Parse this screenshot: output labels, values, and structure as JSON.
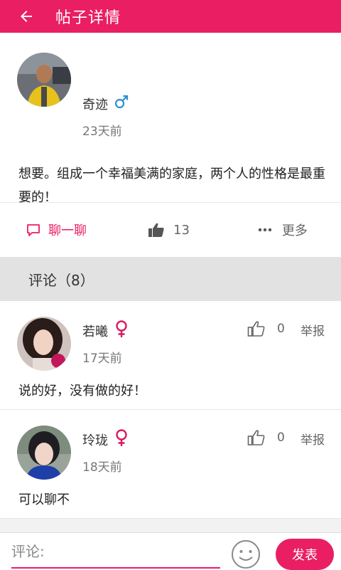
{
  "header": {
    "title": "帖子详情"
  },
  "post": {
    "author": "奇迹",
    "gender": "male",
    "time": "23天前",
    "text": "想要。组成一个幸福美满的家庭，两个人的性格是最重要的！",
    "chat_label": "聊一聊",
    "like_count": "13",
    "more_label": "更多"
  },
  "comments_header": "评论（8）",
  "comments": [
    {
      "name": "若曦",
      "gender": "female",
      "time": "17天前",
      "likes": "0",
      "report": "举报",
      "text": "说的好，没有做的好！"
    },
    {
      "name": "玲珑",
      "gender": "female",
      "time": "18天前",
      "likes": "0",
      "report": "举报",
      "text": "可以聊不"
    }
  ],
  "bottom": {
    "comment_placeholder": "评论:",
    "send_label": "发表"
  },
  "colors": {
    "accent": "#e91e63",
    "male": "#2a8fd6",
    "female": "#d81b60"
  }
}
